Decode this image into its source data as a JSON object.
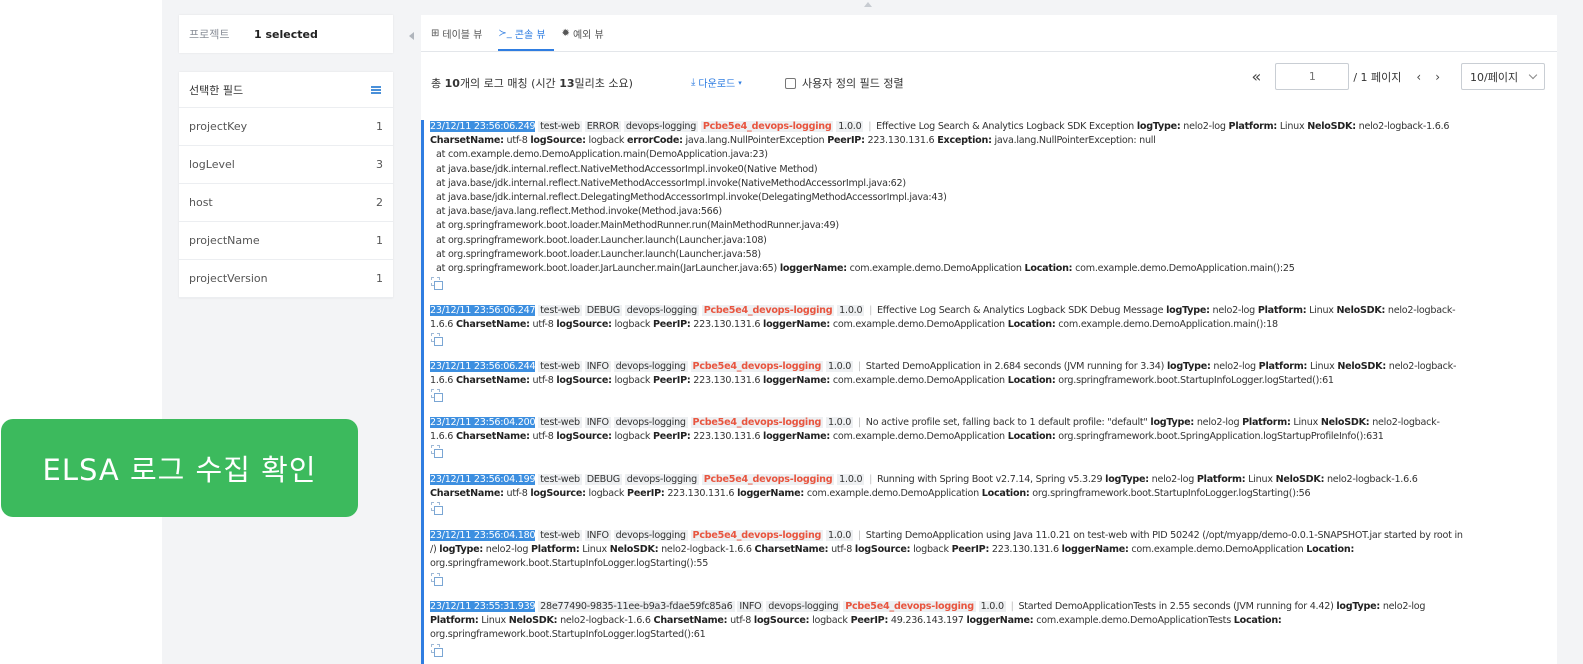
{
  "project": {
    "label": "프로젝트",
    "value": "1 selected"
  },
  "fields": {
    "title": "선택한 필드",
    "items": [
      {
        "name": "projectKey",
        "count": "1"
      },
      {
        "name": "logLevel",
        "count": "3"
      },
      {
        "name": "host",
        "count": "2"
      },
      {
        "name": "projectName",
        "count": "1"
      },
      {
        "name": "projectVersion",
        "count": "1"
      }
    ]
  },
  "tabs": [
    {
      "label": "테이블 뷰",
      "icon": "table-icon",
      "glyph": "⊞"
    },
    {
      "label": "콘솔 뷰",
      "icon": "console-icon",
      "glyph": "≻_"
    },
    {
      "label": "예외 뷰",
      "icon": "bug-icon",
      "glyph": "✹"
    }
  ],
  "toolbar": {
    "summary_pre": "총 ",
    "summary_count": "10",
    "summary_mid": "개의 로그 매칭 (시간 ",
    "summary_ms": "13",
    "summary_post": "밀리초 소요)",
    "download": "다운로드",
    "sort_label": "사용자 정의 필드 정렬"
  },
  "pager": {
    "first": "«",
    "page_placeholder": "1",
    "total": "/ 1 페이지",
    "prev": "‹",
    "next": "›",
    "page_size": "10/페이지"
  },
  "logs": {
    "e1": {
      "ts": "23/12/11 23:56:06.249",
      "host": "test-web",
      "level": "ERROR",
      "name": "devops-logging",
      "key": "Pcbe5e4_devops-logging",
      "ver": "1.0.0",
      "msg": "Effective Log Search & Analytics Logback SDK Exception",
      "logType": "nelo2-log",
      "platform": "Linux",
      "sdk": "nelo2-logback-1.6.6",
      "charset": "utf-8",
      "logSource": "logback",
      "errorCode": "java.lang.NullPointerException",
      "peer": "223.130.131.6",
      "exception": "java.lang.NullPointerException: null",
      "trace": [
        "at com.example.demo.DemoApplication.main(DemoApplication.java:23)",
        "at java.base/jdk.internal.reflect.NativeMethodAccessorImpl.invoke0(Native Method)",
        "at java.base/jdk.internal.reflect.NativeMethodAccessorImpl.invoke(NativeMethodAccessorImpl.java:62)",
        "at java.base/jdk.internal.reflect.DelegatingMethodAccessorImpl.invoke(DelegatingMethodAccessorImpl.java:43)",
        "at java.base/java.lang.reflect.Method.invoke(Method.java:566)",
        "at org.springframework.boot.loader.MainMethodRunner.run(MainMethodRunner.java:49)",
        "at org.springframework.boot.loader.Launcher.launch(Launcher.java:108)",
        "at org.springframework.boot.loader.Launcher.launch(Launcher.java:58)",
        "at org.springframework.boot.loader.JarLauncher.main(JarLauncher.java:65)"
      ],
      "loggerName": "com.example.demo.DemoApplication",
      "location": "com.example.demo.DemoApplication.main():25"
    },
    "e2": {
      "ts": "23/12/11 23:56:06.247",
      "host": "test-web",
      "level": "DEBUG",
      "name": "devops-logging",
      "key": "Pcbe5e4_devops-logging",
      "ver": "1.0.0",
      "msg": "Effective Log Search & Analytics Logback SDK Debug Message",
      "logType": "nelo2-log",
      "platform": "Linux",
      "sdk_a": "nelo2-logback-",
      "sdk_b": "1.6.6",
      "charset": "utf-8",
      "logSource": "logback",
      "peer": "223.130.131.6",
      "loggerName": "com.example.demo.DemoApplication",
      "location": "com.example.demo.DemoApplication.main():18"
    },
    "e3": {
      "ts": "23/12/11 23:56:06.244",
      "host": "test-web",
      "level": "INFO",
      "name": "devops-logging",
      "key": "Pcbe5e4_devops-logging",
      "ver": "1.0.0",
      "msg": "Started DemoApplication in 2.684 seconds (JVM running for 3.34)",
      "logType": "nelo2-log",
      "platform": "Linux",
      "sdk_a": "nelo2-logback-",
      "sdk_b": "1.6.6",
      "charset": "utf-8",
      "logSource": "logback",
      "peer": "223.130.131.6",
      "loggerName": "com.example.demo.DemoApplication",
      "location": "org.springframework.boot.StartupInfoLogger.logStarted():61"
    },
    "e4": {
      "ts": "23/12/11 23:56:04.200",
      "host": "test-web",
      "level": "INFO",
      "name": "devops-logging",
      "key": "Pcbe5e4_devops-logging",
      "ver": "1.0.0",
      "msg": "No active profile set, falling back to 1 default profile: \"default\"",
      "logType": "nelo2-log",
      "platform": "Linux",
      "sdk_a": "nelo2-logback-",
      "sdk_b": "1.6.6",
      "charset": "utf-8",
      "logSource": "logback",
      "peer": "223.130.131.6",
      "loggerName": "com.example.demo.DemoApplication",
      "location": "org.springframework.boot.SpringApplication.logStartupProfileInfo():631"
    },
    "e5": {
      "ts": "23/12/11 23:56:04.199",
      "host": "test-web",
      "level": "DEBUG",
      "name": "devops-logging",
      "key": "Pcbe5e4_devops-logging",
      "ver": "1.0.0",
      "msg": "Running with Spring Boot v2.7.14, Spring v5.3.29",
      "logType": "nelo2-log",
      "platform": "Linux",
      "sdk": "nelo2-logback-1.6.6",
      "charset": "utf-8",
      "logSource": "logback",
      "peer": "223.130.131.6",
      "loggerName": "com.example.demo.DemoApplication",
      "location": "org.springframework.boot.StartupInfoLogger.logStarting():56"
    },
    "e6": {
      "ts": "23/12/11 23:56:04.180",
      "host": "test-web",
      "level": "INFO",
      "name": "devops-logging",
      "key": "Pcbe5e4_devops-logging",
      "ver": "1.0.0",
      "msg_a": "Starting DemoApplication using Java 11.0.21 on test-web with PID 50242 (/opt/myapp/demo-0.0.1-SNAPSHOT.jar started by root in",
      "msg_b": "/)",
      "logType": "nelo2-log",
      "platform": "Linux",
      "sdk": "nelo2-logback-1.6.6",
      "charset": "utf-8",
      "logSource": "logback",
      "peer": "223.130.131.6",
      "loggerName": "com.example.demo.DemoApplication",
      "location": "org.springframework.boot.StartupInfoLogger.logStarting():55"
    },
    "e7": {
      "ts": "23/12/11 23:55:31.939",
      "host": "28e77490-9835-11ee-b9a3-fdae59fc85a6",
      "level": "INFO",
      "name": "devops-logging",
      "key": "Pcbe5e4_devops-logging",
      "ver": "1.0.0",
      "msg": "Started DemoApplicationTests in 2.55 seconds (JVM running for 4.42)",
      "logType": "nelo2-log",
      "platform": "Linux",
      "sdk": "nelo2-logback-1.6.6",
      "charset": "utf-8",
      "logSource": "logback",
      "peer": "49.236.143.197",
      "loggerName": "com.example.demo.DemoApplicationTests",
      "location": "org.springframework.boot.StartupInfoLogger.logStarted():61"
    }
  },
  "labels": {
    "logType": "logType:",
    "platform": "Platform:",
    "sdk": "NeloSDK:",
    "charset": "CharsetName:",
    "logSource": "logSource:",
    "errorCode": "errorCode:",
    "peer": "PeerIP:",
    "exception": "Exception:",
    "loggerName": "loggerName:",
    "location": "Location:"
  },
  "banner": {
    "text": "ELSA 로그 수집 확인"
  },
  "colors": {
    "accent": "#2f7de1",
    "timestamp_bg": "#3d8fe0",
    "project_key": "#e8553f",
    "banner": "#3cba5d"
  }
}
